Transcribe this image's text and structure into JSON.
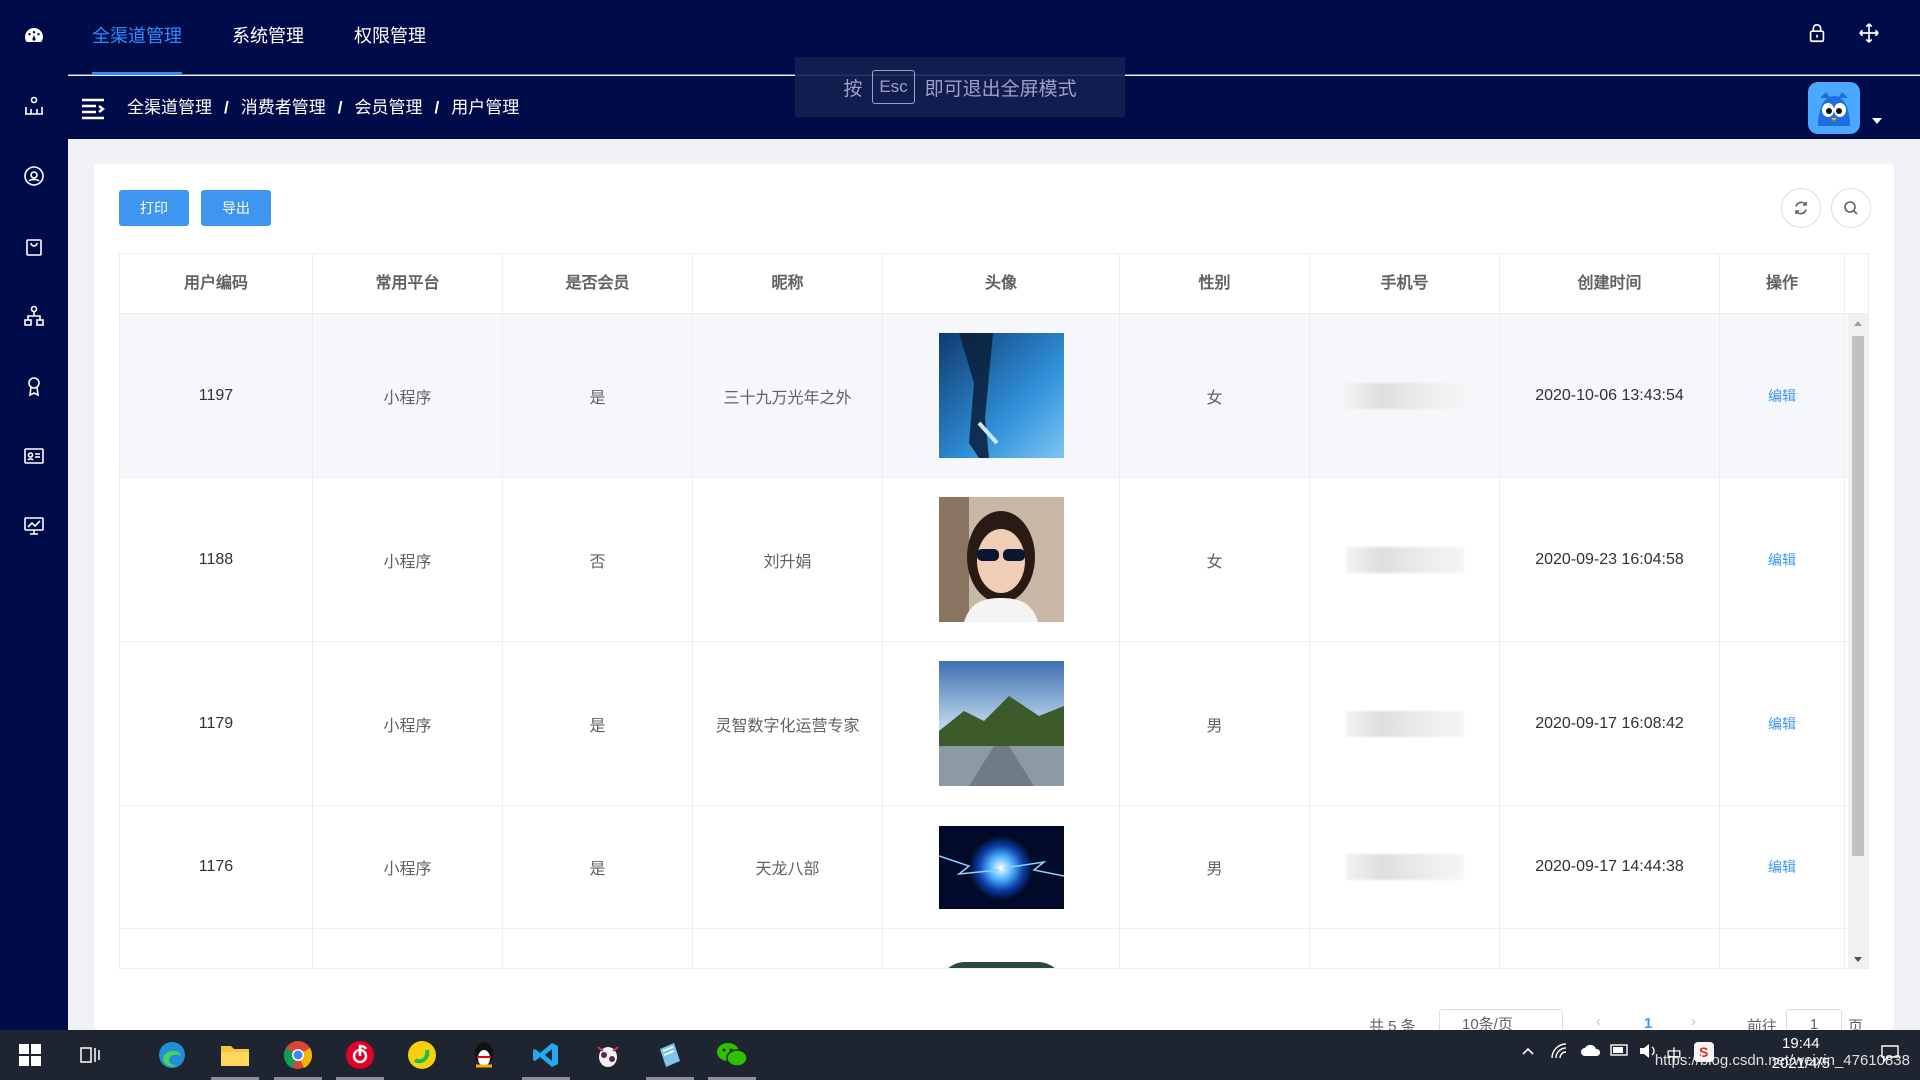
{
  "topnav": {
    "tabs": [
      {
        "label": "全渠道管理",
        "active": true
      },
      {
        "label": "系统管理",
        "active": false
      },
      {
        "label": "权限管理",
        "active": false
      }
    ]
  },
  "breadcrumb": [
    "全渠道管理",
    "消费者管理",
    "会员管理",
    "用户管理"
  ],
  "breadcrumb_separator": "/",
  "toast": {
    "prefix": "按",
    "key": "Esc",
    "suffix": "即可退出全屏模式"
  },
  "toolbar": {
    "print_label": "打印",
    "export_label": "导出"
  },
  "table": {
    "columns": [
      "用户编码",
      "常用平台",
      "是否会员",
      "昵称",
      "头像",
      "性别",
      "手机号",
      "创建时间",
      "操作"
    ],
    "rows": [
      {
        "id": "1197",
        "platform": "小程序",
        "member": "是",
        "nickname": "三十九万光年之外",
        "avatar": "blue-photo",
        "gender": "女",
        "created": "2020-10-06 13:43:54",
        "action": "编辑"
      },
      {
        "id": "1188",
        "platform": "小程序",
        "member": "否",
        "nickname": "刘升娟",
        "avatar": "woman-sunglasses-photo",
        "gender": "女",
        "created": "2020-09-23 16:04:58",
        "action": "编辑"
      },
      {
        "id": "1179",
        "platform": "小程序",
        "member": "是",
        "nickname": "灵智数字化运营专家",
        "avatar": "mountain-landscape-photo",
        "gender": "男",
        "created": "2020-09-17 16:08:42",
        "action": "编辑"
      },
      {
        "id": "1176",
        "platform": "小程序",
        "member": "是",
        "nickname": "天龙八部",
        "avatar": "energy-orb-photo",
        "gender": "男",
        "created": "2020-09-17 14:44:38",
        "action": "编辑"
      }
    ]
  },
  "pagination": {
    "total": "共 5 条",
    "page_size": "10条/页",
    "current_page": "1",
    "goto_label": "前往",
    "goto_value": "1",
    "page_unit": "页"
  },
  "taskbar": {
    "time": "19:44",
    "date": "2021/4/5",
    "watermark": "https://blog.csdn.net/weixin_47610838"
  },
  "colors": {
    "nav_bg": "#000c4a",
    "accent": "#3f96f0",
    "active_tab": "#2f8cff"
  }
}
